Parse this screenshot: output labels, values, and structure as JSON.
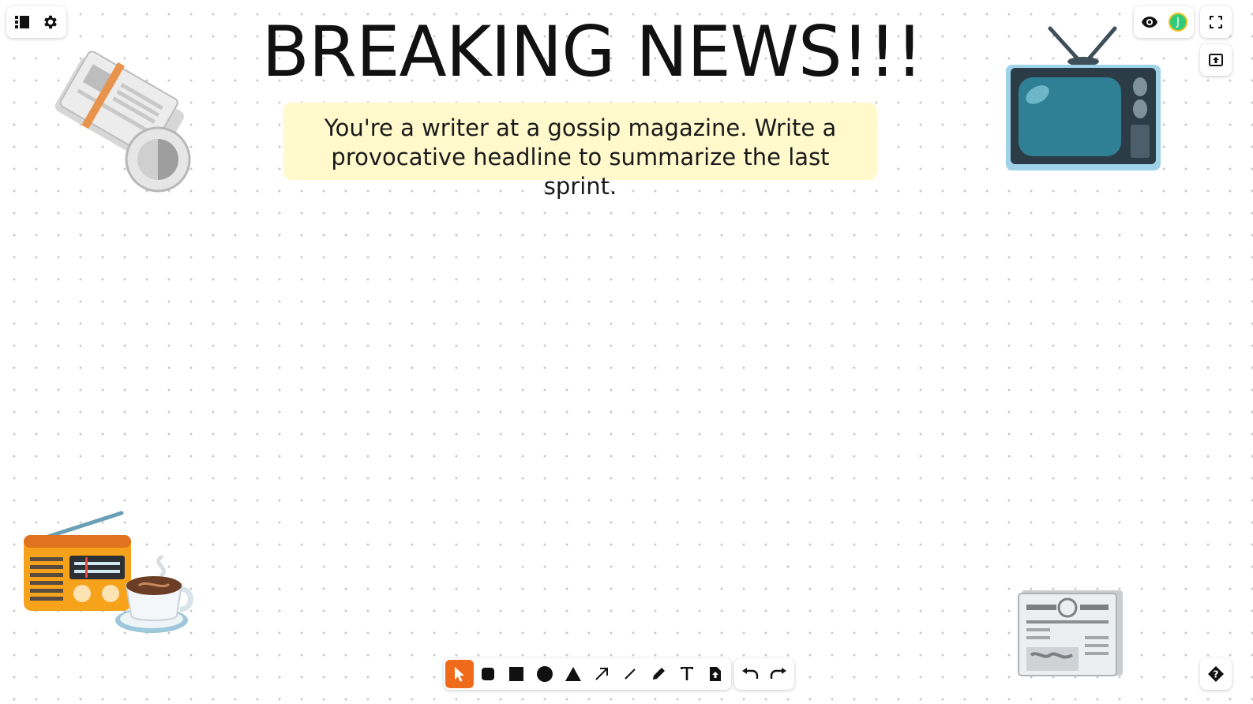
{
  "canvas": {
    "title": "BREAKING NEWS!!!",
    "prompt": "You're a writer at a gossip magazine. Write a provocative headline to summarize the last sprint."
  },
  "top_left_menu": {
    "items": [
      {
        "icon": "list-icon"
      },
      {
        "icon": "gear-icon"
      }
    ]
  },
  "top_right_menu": {
    "view_icon": "eye-icon",
    "avatar_initial": "J",
    "avatar_color": "#2fca7a",
    "avatar_ring_color": "#f2c21b"
  },
  "side_controls": {
    "fullscreen_icon": "fullscreen-icon",
    "export_icon": "export-icon",
    "help_icon": "help-icon"
  },
  "toolbar": {
    "active_tool": "select",
    "accent_color": "#f06a1c",
    "tools": [
      "select",
      "rounded-rectangle",
      "rectangle",
      "circle",
      "triangle",
      "arrow",
      "line",
      "pencil",
      "text",
      "upload"
    ],
    "history": [
      "undo",
      "redo"
    ]
  },
  "stickers": [
    "rolled-newspaper",
    "television",
    "radio",
    "coffee-cup",
    "newspaper"
  ],
  "colors": {
    "sticky_note": "#fff9cc",
    "dot_grid": "#c8c8c8"
  }
}
